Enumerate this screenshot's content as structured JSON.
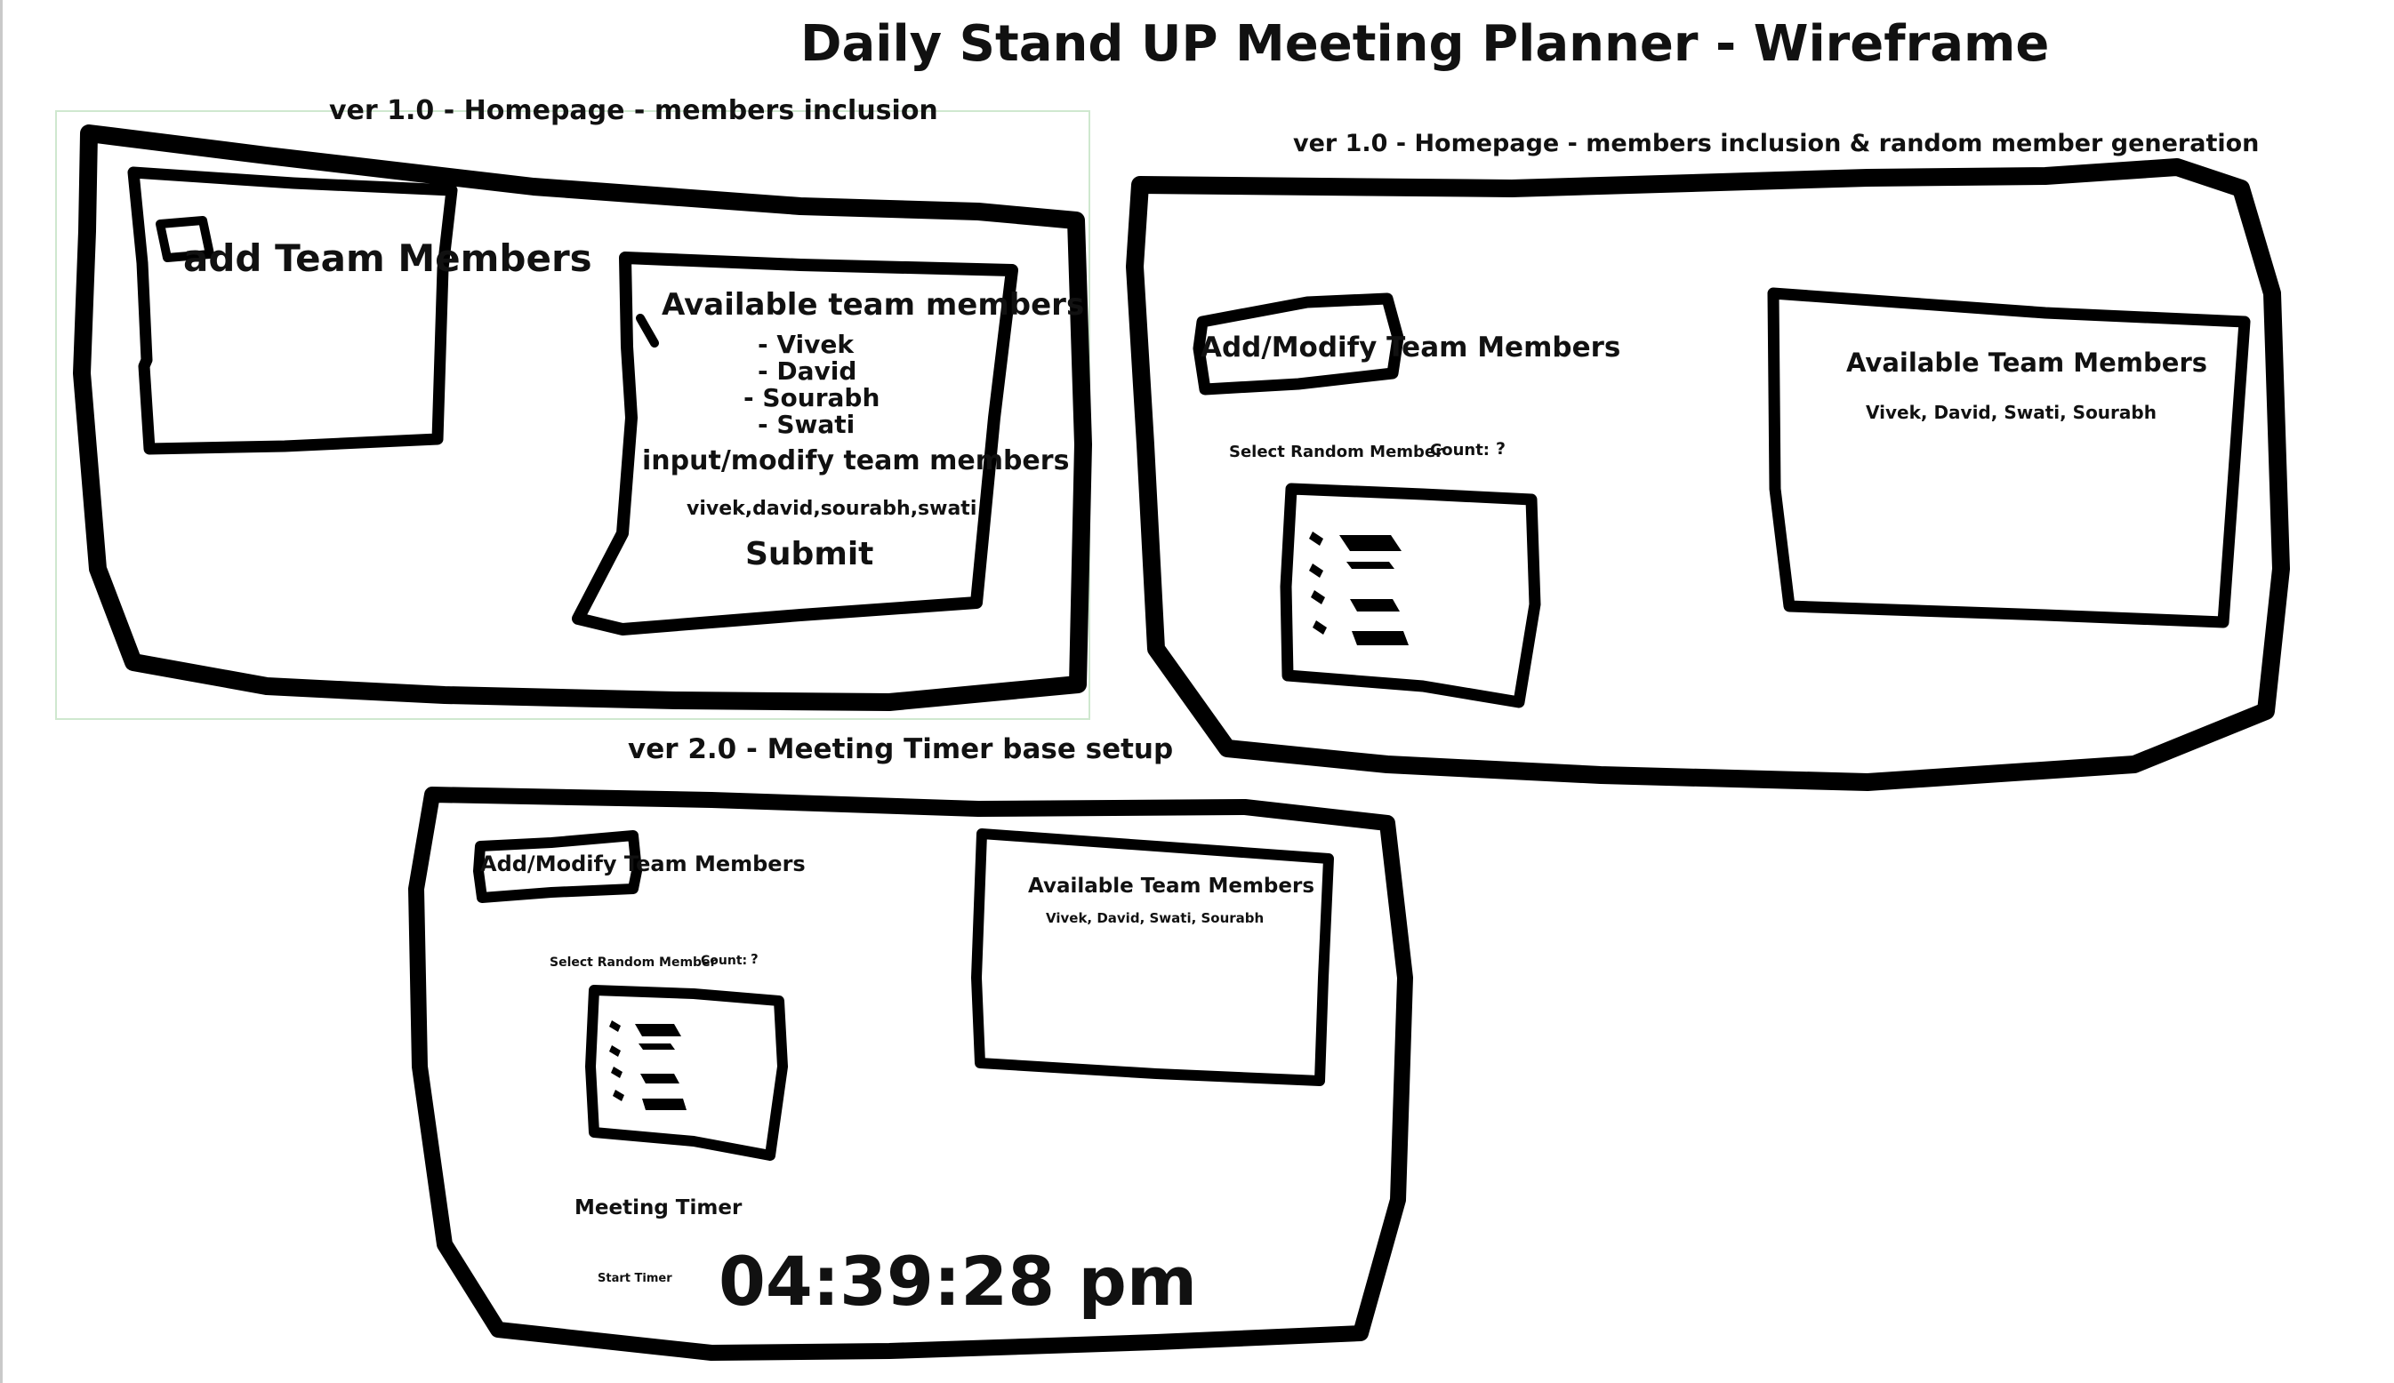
{
  "title": "Daily Stand UP Meeting Planner - Wireframe",
  "frame_a": {
    "label": "ver 1.0 - Homepage - members inclusion",
    "add_button_label": "add Team Members",
    "panel": {
      "heading": "Available team members",
      "members": [
        "- Vivek",
        "- David",
        "- Sourabh",
        "- Swati"
      ],
      "input_label": "input/modify team members",
      "input_value": "vivek,david,sourabh,swati",
      "submit_label": "Submit"
    }
  },
  "frame_b": {
    "label": "ver 1.0 - Homepage - members inclusion & random member generation",
    "modify_button_label": "Add/Modify Team Members",
    "select_random_label": "Select Random Member",
    "count_label": "Count:",
    "count_value": "?",
    "panel": {
      "heading": "Available Team Members",
      "members_text": "Vivek, David, Swati, Sourabh"
    }
  },
  "frame_c": {
    "label": "ver 2.0 - Meeting Timer base setup",
    "modify_button_label": "Add/Modify Team Members",
    "select_random_label": "Select Random Member",
    "count_label": "Count:",
    "count_value": "?",
    "panel": {
      "heading": "Available Team Members",
      "members_text": "Vivek, David, Swati, Sourabh"
    },
    "timer_label": "Meeting Timer",
    "start_label": "Start Timer",
    "clock": "04:39:28 pm"
  },
  "icons": {
    "list": "list-icon"
  }
}
